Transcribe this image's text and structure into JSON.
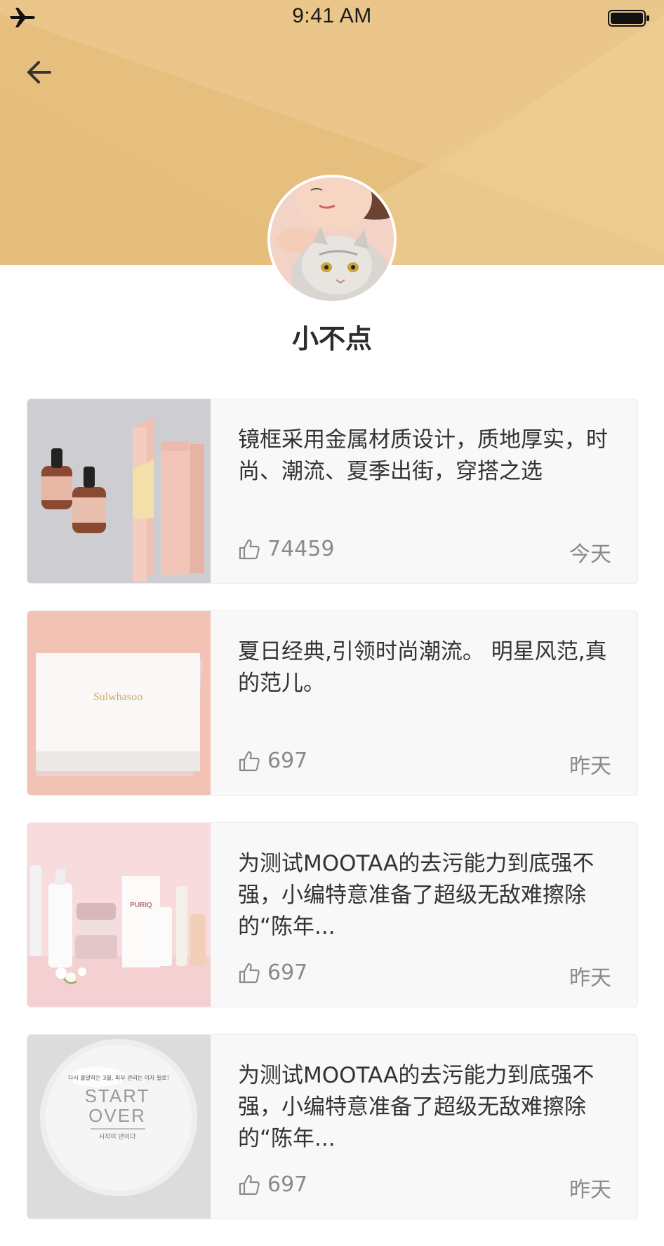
{
  "status_bar": {
    "time": "9:41 AM",
    "airplane_icon": "airplane-icon",
    "battery_icon": "battery-icon"
  },
  "header": {
    "back_icon": "arrow-left-icon",
    "background_color": "#e8c283"
  },
  "profile": {
    "name": "小不点"
  },
  "posts": [
    {
      "text": "镜框采用金属材质设计，质地厚实，时尚、潮流、夏季出街，穿搭之选",
      "likes": "74459",
      "date": "今天",
      "thumb_text": ""
    },
    {
      "text": "夏日经典,引领时尚潮流。 明星风范,真的范儿。",
      "likes": "697",
      "date": "昨天",
      "thumb_text": "Sulwhasoo"
    },
    {
      "text": "为测试MOOTAA的去污能力到底强不强，小编特意准备了超级无敌难擦除的“陈年...",
      "likes": "697",
      "date": "昨天",
      "thumb_text": "PURIQ"
    },
    {
      "text": "为测试MOOTAA的去污能力到底强不强，小编特意准备了超级无敌难擦除的“陈年...",
      "likes": "697",
      "date": "昨天",
      "thumb_text_top": "다시 출발하는 3월, 피부 관리는 이자 필로!",
      "thumb_text_line1": "START",
      "thumb_text_line2": "OVER",
      "thumb_text_bottom": "시작이 반이다"
    }
  ],
  "colors": {
    "accent": "#e8c283",
    "card_bg": "#f8f8f8",
    "meta_text": "#8a8a8a"
  }
}
